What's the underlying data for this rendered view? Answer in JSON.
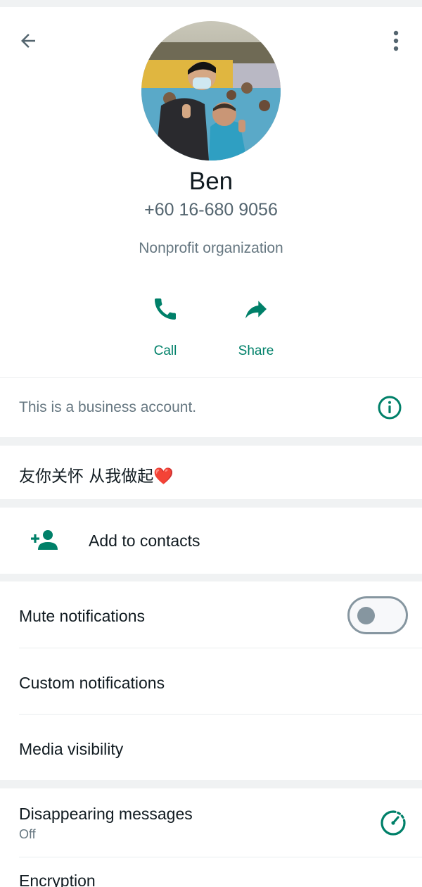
{
  "header": {
    "back_icon": "arrow-back-icon",
    "menu_icon": "more-vert-icon",
    "name": "Ben",
    "phone": "+60 16-680 9056",
    "category": "Nonprofit organization"
  },
  "actions": {
    "call": {
      "label": "Call",
      "icon": "phone-icon"
    },
    "share": {
      "label": "Share",
      "icon": "share-icon"
    }
  },
  "business": {
    "text": "This is a business account.",
    "icon": "info-icon"
  },
  "about": {
    "text": "友你关怀 从我做起❤️"
  },
  "contacts": {
    "label": "Add to contacts",
    "icon": "add-person-icon"
  },
  "settings": {
    "mute": {
      "label": "Mute notifications",
      "enabled": false
    },
    "custom": {
      "label": "Custom notifications"
    },
    "media": {
      "label": "Media visibility"
    }
  },
  "privacy": {
    "disappearing": {
      "label": "Disappearing messages",
      "value": "Off",
      "icon": "timer-icon"
    },
    "encryption": {
      "label": "Encryption"
    }
  },
  "colors": {
    "accent": "#008069",
    "text_primary": "#111b21",
    "text_secondary": "#667781",
    "background": "#f0f2f3"
  }
}
